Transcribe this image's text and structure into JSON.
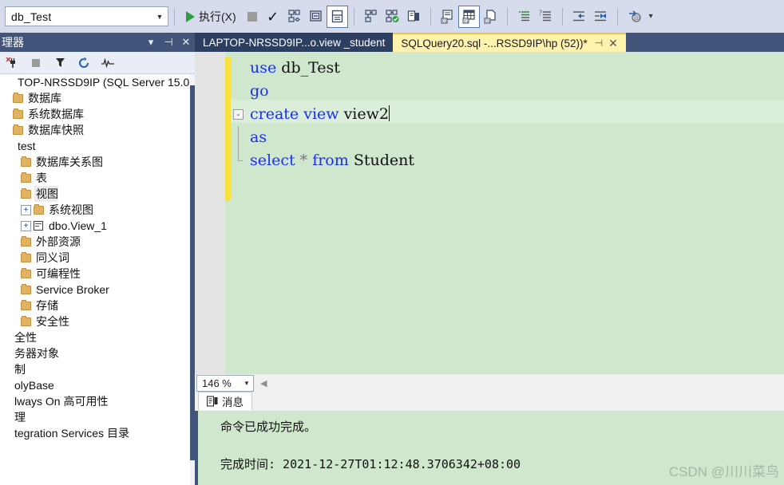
{
  "toolbar": {
    "database_value": "db_Test",
    "execute_label": "执行(X)",
    "icons": [
      "play-icon",
      "stop-icon",
      "check-parse-icon",
      "display-estimated-plan-icon",
      "query-options-icon",
      "include-actual-plan-icon",
      "include-live-stats-icon",
      "results-to-text-icon",
      "results-to-grid-icon",
      "results-to-file-icon",
      "comment-icon",
      "uncomment-icon",
      "decrease-indent-icon",
      "increase-indent-icon",
      "specify-values-icon"
    ],
    "overflow_label": "toolbar-overflow"
  },
  "sidebar": {
    "title": "理器",
    "header_icons": [
      "chevron-down-icon",
      "pin-icon",
      "close-icon"
    ],
    "tool_icons": [
      "connect-icon",
      "disconnect-icon",
      "stop-icon",
      "filter-icon",
      "refresh-icon",
      "activity-monitor-icon"
    ],
    "tree": [
      {
        "label": "TOP-NRSSD9IP (SQL Server 15.0..",
        "indent": 0,
        "icon": "server-icon",
        "expander": "",
        "selected": false
      },
      {
        "label": "数据库",
        "indent": 0,
        "icon": "folder-icon",
        "expander": "",
        "selected": false
      },
      {
        "label": "系统数据库",
        "indent": 1,
        "icon": "folder-icon",
        "expander": "",
        "selected": false
      },
      {
        "label": "数据库快照",
        "indent": 1,
        "icon": "folder-icon",
        "expander": "",
        "selected": false
      },
      {
        "label": "test",
        "indent": 1,
        "icon": "db-icon",
        "expander": "",
        "selected": false
      },
      {
        "label": "数据库关系图",
        "indent": 2,
        "icon": "folder-icon",
        "expander": "",
        "selected": false
      },
      {
        "label": "表",
        "indent": 2,
        "icon": "folder-icon",
        "expander": "",
        "selected": false
      },
      {
        "label": "视图",
        "indent": 2,
        "icon": "folder-icon",
        "expander": "",
        "selected": true
      },
      {
        "label": "系统视图",
        "indent": 3,
        "icon": "folder-icon",
        "expander": "+",
        "selected": false
      },
      {
        "label": "dbo.View_1",
        "indent": 3,
        "icon": "view-icon",
        "expander": "+",
        "selected": false
      },
      {
        "label": "外部资源",
        "indent": 2,
        "icon": "folder-icon",
        "expander": "",
        "selected": false
      },
      {
        "label": "同义词",
        "indent": 2,
        "icon": "folder-icon",
        "expander": "",
        "selected": false
      },
      {
        "label": "可编程性",
        "indent": 2,
        "icon": "folder-icon",
        "expander": "",
        "selected": false
      },
      {
        "label": "Service Broker",
        "indent": 2,
        "icon": "folder-icon",
        "expander": "",
        "selected": false
      },
      {
        "label": "存储",
        "indent": 2,
        "icon": "folder-icon",
        "expander": "",
        "selected": false
      },
      {
        "label": "安全性",
        "indent": 2,
        "icon": "folder-icon",
        "expander": "",
        "selected": false
      },
      {
        "label": "全性",
        "indent": 0,
        "icon": "none",
        "expander": "",
        "selected": false
      },
      {
        "label": "务器对象",
        "indent": 0,
        "icon": "none",
        "expander": "",
        "selected": false
      },
      {
        "label": "制",
        "indent": 0,
        "icon": "none",
        "expander": "",
        "selected": false
      },
      {
        "label": "olyBase",
        "indent": 0,
        "icon": "none",
        "expander": "",
        "selected": false
      },
      {
        "label": "lways On 高可用性",
        "indent": 0,
        "icon": "none",
        "expander": "",
        "selected": false
      },
      {
        "label": "理",
        "indent": 0,
        "icon": "none",
        "expander": "",
        "selected": false
      },
      {
        "label": "tegration Services 目录",
        "indent": 0,
        "icon": "none",
        "expander": "",
        "selected": false
      }
    ]
  },
  "tabs": [
    {
      "label": "LAPTOP-NRSSD9IP...o.view _student",
      "active": false
    },
    {
      "label": "SQLQuery20.sql -...RSSD9IP\\hp (52))*",
      "active": true,
      "pin": "pin-icon",
      "close": "close-icon"
    }
  ],
  "editor": {
    "lines": [
      {
        "text": "use db_Test",
        "tokens": [
          {
            "t": "use ",
            "c": "kw"
          },
          {
            "t": "db_Test",
            "c": "id"
          }
        ],
        "fold": "",
        "bar": false
      },
      {
        "text": "go",
        "tokens": [
          {
            "t": "go",
            "c": "kw"
          }
        ],
        "fold": "",
        "bar": false
      },
      {
        "text": "create view view2",
        "tokens": [
          {
            "t": "create view ",
            "c": "kw"
          },
          {
            "t": "view2",
            "c": "id"
          }
        ],
        "fold": "-",
        "bar": false,
        "caret": true
      },
      {
        "text": "as",
        "tokens": [
          {
            "t": "as",
            "c": "kw"
          }
        ],
        "fold": "",
        "bar": true
      },
      {
        "text": "select * from Student",
        "tokens": [
          {
            "t": "select ",
            "c": "kw"
          },
          {
            "t": "*",
            "c": "op"
          },
          {
            "t": " ",
            "c": "id"
          },
          {
            "t": "from ",
            "c": "kw"
          },
          {
            "t": "Student",
            "c": "id"
          }
        ],
        "fold": "",
        "bar": true
      }
    ]
  },
  "zoom_bar": {
    "zoom_value": "146 %",
    "scroll_left_icon": "scroll-left-arrow-icon"
  },
  "results": {
    "tab_label": "消息",
    "tab_icon": "messages-icon",
    "line1": "命令已成功完成。",
    "line2": "完成时间: 2021-12-27T01:12:48.3706342+08:00"
  },
  "watermark": "CSDN @川川菜鸟",
  "colors": {
    "title_bar": "#41547a",
    "toolbar_bg": "#d6dcec",
    "editor_bg": "#cfe7cd",
    "active_tab": "#fff2ad",
    "change_bar": "#f7e03c",
    "keyword": "#1a30f0",
    "folder": "#e0b264"
  }
}
